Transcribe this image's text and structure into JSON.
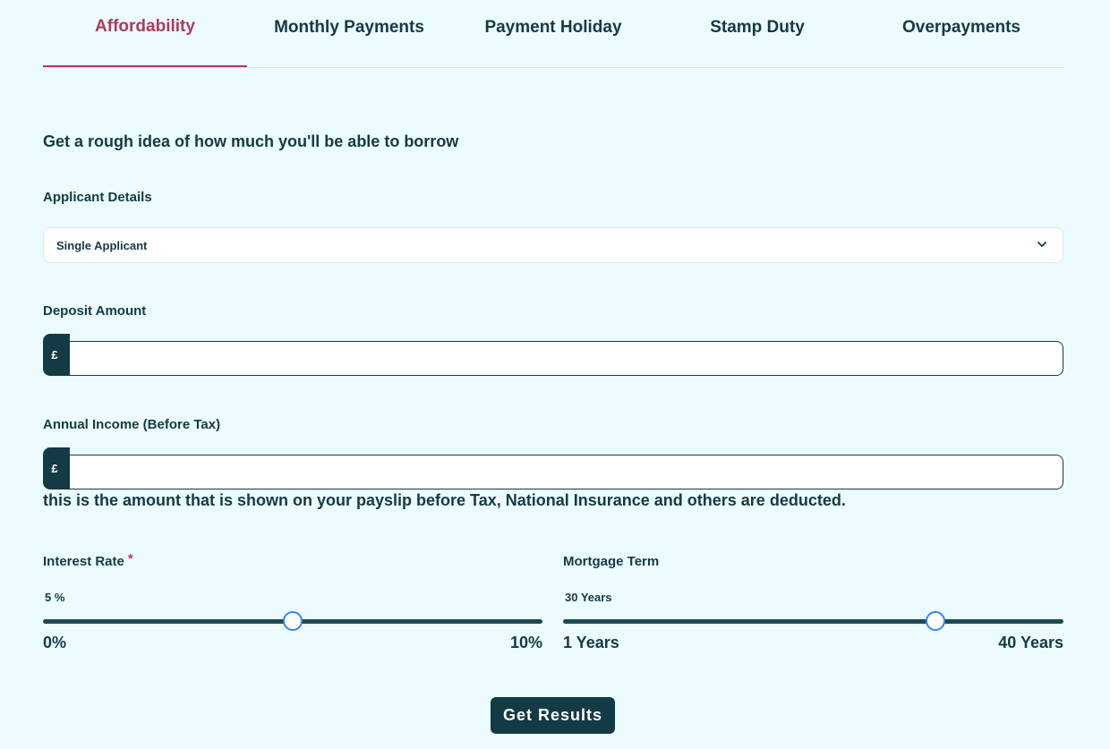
{
  "tabs": [
    {
      "label": "Affordability",
      "active": true
    },
    {
      "label": "Monthly Payments",
      "active": false
    },
    {
      "label": "Payment Holiday",
      "active": false
    },
    {
      "label": "Stamp Duty",
      "active": false
    },
    {
      "label": "Overpayments",
      "active": false
    }
  ],
  "intro": "Get a rough idea of how much you'll be able to borrow",
  "applicant": {
    "label": "Applicant Details",
    "selected": "Single Applicant"
  },
  "deposit": {
    "label": "Deposit Amount",
    "prefix": "£",
    "value": ""
  },
  "income": {
    "label": "Annual Income (Before Tax)",
    "prefix": "£",
    "value": "",
    "hint": "this is the amount that is shown on your payslip before Tax, National Insurance and others are deducted."
  },
  "interest": {
    "label": "Interest Rate",
    "required_mark": "*",
    "value_text": "5 %",
    "value": 5,
    "min": 0,
    "max": 10,
    "min_label": "0%",
    "max_label": "10%"
  },
  "term": {
    "label": "Mortgage Term",
    "value_text": "30 Years",
    "value": 30,
    "min": 1,
    "max": 40,
    "min_label": "1 Years",
    "max_label": "40 Years"
  },
  "submit_label": "Get Results",
  "colors": {
    "background": "#ecfbfd",
    "primary": "#143a45",
    "accent": "#b03a5b",
    "thumb_border": "#3b82f6"
  },
  "icons": {
    "select_chevron": "chevron-down-icon"
  }
}
